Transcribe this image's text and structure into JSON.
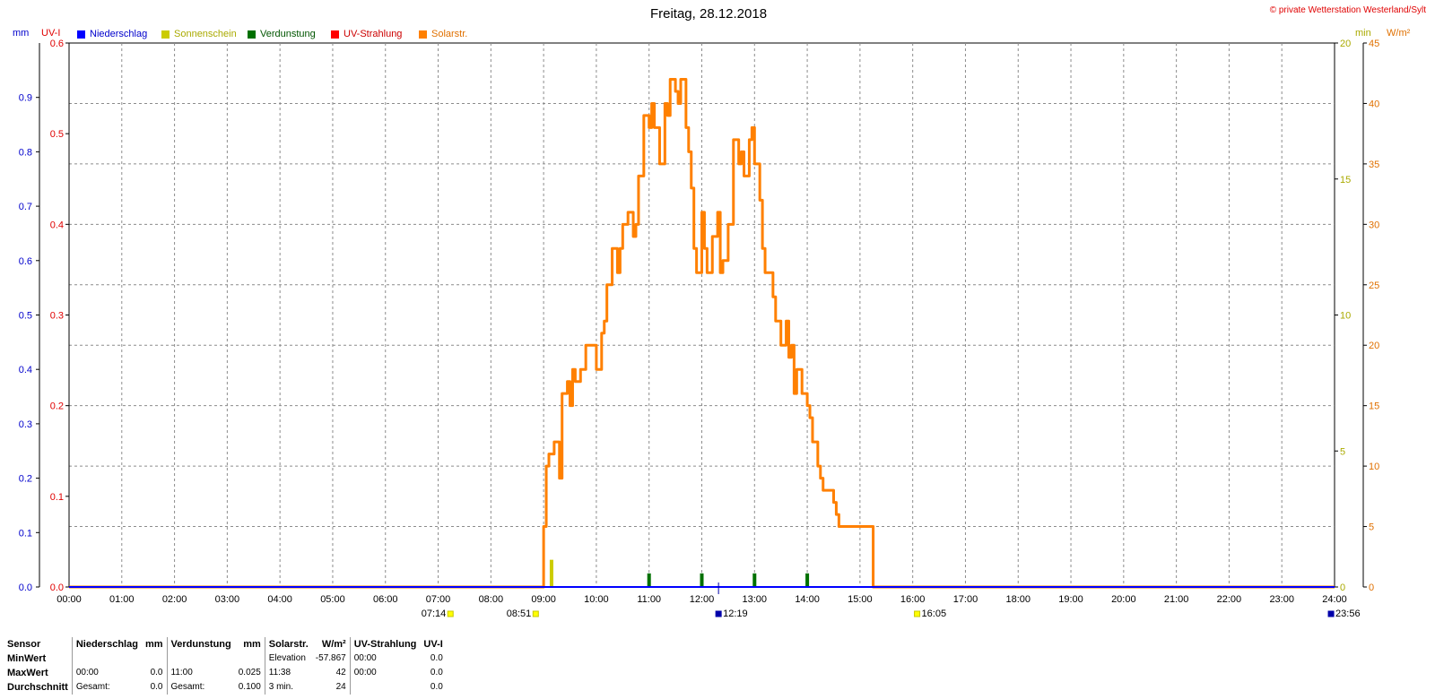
{
  "header": {
    "title": "Freitag, 28.12.2018",
    "copyright": "© private Wetterstation Westerland/Sylt"
  },
  "legend": [
    {
      "label": "Niederschlag",
      "color": "#0000ff",
      "text_color": "#0000cc"
    },
    {
      "label": "Sonnenschein",
      "color": "#cccc00",
      "text_color": "#aaaa00"
    },
    {
      "label": "Verdunstung",
      "color": "#007000",
      "text_color": "#005500"
    },
    {
      "label": "UV-Strahlung",
      "color": "#ff0000",
      "text_color": "#cc0000"
    },
    {
      "label": "Solarstr.",
      "color": "#ff8000",
      "text_color": "#e07000"
    }
  ],
  "axes": {
    "left_units": [
      "mm",
      "UV-I"
    ],
    "right_units": [
      "min",
      "W/m²"
    ],
    "mm_ticks": [
      "0.0",
      "0.1",
      "0.2",
      "0.3",
      "0.4",
      "0.5",
      "0.6",
      "0.7",
      "0.8",
      "0.9"
    ],
    "uv_ticks": [
      "0.0",
      "0.1",
      "0.2",
      "0.3",
      "0.4",
      "0.5",
      "0.6"
    ],
    "min_ticks": [
      "0",
      "5",
      "10",
      "15",
      "20"
    ],
    "wm2_ticks": [
      "0",
      "5",
      "10",
      "15",
      "20",
      "25",
      "30",
      "35",
      "40",
      "45"
    ],
    "x_ticks": [
      "00:00",
      "01:00",
      "02:00",
      "03:00",
      "04:00",
      "05:00",
      "06:00",
      "07:00",
      "08:00",
      "09:00",
      "10:00",
      "11:00",
      "12:00",
      "13:00",
      "14:00",
      "15:00",
      "16:00",
      "17:00",
      "18:00",
      "19:00",
      "20:00",
      "21:00",
      "22:00",
      "23:00",
      "24:00"
    ],
    "x_range_hours": [
      0,
      24
    ],
    "wm2_range": [
      0,
      45
    ],
    "min_range": [
      0,
      20
    ],
    "grid": true
  },
  "sun_markers": [
    {
      "label": "07:14",
      "hour": 7.233,
      "kind": "sunrise"
    },
    {
      "label": "08:51",
      "hour": 8.85,
      "kind": "sunrise-solar"
    },
    {
      "label": "12:19",
      "hour": 12.317,
      "kind": "noon"
    },
    {
      "label": "16:05",
      "hour": 16.083,
      "kind": "sunset"
    },
    {
      "label": "23:56",
      "hour": 23.933,
      "kind": "moon"
    }
  ],
  "chart_data": {
    "type": "line",
    "title": "Freitag, 28.12.2018",
    "xlabel": "",
    "ylabel": "W/m²",
    "xlim": [
      0,
      24
    ],
    "ylim": [
      0,
      45
    ],
    "series": [
      {
        "name": "Solarstr.",
        "unit": "W/m²",
        "color": "#ff8000",
        "x": [
          0,
          8.95,
          9.0,
          9.05,
          9.1,
          9.15,
          9.2,
          9.3,
          9.35,
          9.45,
          9.5,
          9.55,
          9.6,
          9.7,
          9.8,
          9.9,
          10.0,
          10.1,
          10.15,
          10.2,
          10.3,
          10.4,
          10.45,
          10.5,
          10.6,
          10.7,
          10.75,
          10.8,
          10.9,
          11.0,
          11.05,
          11.1,
          11.2,
          11.3,
          11.35,
          11.4,
          11.5,
          11.55,
          11.6,
          11.7,
          11.75,
          11.8,
          11.85,
          11.9,
          12.0,
          12.05,
          12.1,
          12.15,
          12.2,
          12.3,
          12.35,
          12.4,
          12.5,
          12.6,
          12.7,
          12.75,
          12.8,
          12.9,
          12.95,
          13.0,
          13.1,
          13.15,
          13.2,
          13.3,
          13.35,
          13.4,
          13.5,
          13.6,
          13.65,
          13.7,
          13.75,
          13.8,
          13.9,
          14.0,
          14.05,
          14.1,
          14.2,
          14.25,
          14.3,
          14.4,
          14.5,
          14.55,
          14.6,
          14.7,
          14.8,
          14.9,
          15.0,
          15.05,
          15.1,
          15.15,
          15.2,
          15.25,
          24
        ],
        "y": [
          0,
          0,
          5,
          10,
          11,
          11,
          12,
          9,
          16,
          17,
          15,
          18,
          17,
          18,
          20,
          20,
          18,
          21,
          22,
          25,
          28,
          26,
          28,
          30,
          31,
          29,
          30,
          34,
          39,
          38,
          40,
          38,
          35,
          40,
          39,
          42,
          41,
          40,
          42,
          38,
          36,
          33,
          28,
          26,
          31,
          28,
          26,
          26,
          29,
          31,
          26,
          27,
          30,
          37,
          35,
          36,
          34,
          37,
          38,
          35,
          32,
          28,
          26,
          26,
          24,
          22,
          20,
          22,
          19,
          20,
          16,
          18,
          16,
          15,
          14,
          12,
          10,
          9,
          8,
          8,
          7,
          6,
          5,
          5,
          5,
          5,
          5,
          5,
          5,
          5,
          5,
          0,
          0
        ],
        "summary": {
          "min": "00:00",
          "min_value": 0.0,
          "max_time": "11:38",
          "max_value": 42,
          "mean_3min": 24
        }
      },
      {
        "name": "UV-Strahlung",
        "unit": "UV-I",
        "color": "#ff0000",
        "x": [
          0,
          24
        ],
        "y": [
          0,
          0
        ]
      },
      {
        "name": "Niederschlag",
        "unit": "mm",
        "color": "#0000ff",
        "x": [
          0,
          24
        ],
        "y": [
          0,
          0
        ]
      },
      {
        "name": "Sonnenschein",
        "unit": "min",
        "color": "#cccc00",
        "bars": [
          {
            "x": 9.15,
            "y": 1.0
          }
        ]
      },
      {
        "name": "Verdunstung",
        "unit": "mm",
        "color": "#007000",
        "bars": [
          {
            "x": 11.0,
            "y": 0.025
          },
          {
            "x": 12.0,
            "y": 0.025
          },
          {
            "x": 13.0,
            "y": 0.025
          },
          {
            "x": 14.0,
            "y": 0.025
          }
        ]
      }
    ]
  },
  "stats": {
    "row_labels": [
      "Sensor",
      "MinWert",
      "MaxWert",
      "Durchschnitt"
    ],
    "niederschlag": {
      "header": "Niederschlag",
      "unit": "mm",
      "min": "",
      "max_time": "00:00",
      "max": "0.0",
      "avg_label": "Gesamt:",
      "avg": "0.0"
    },
    "verdunstung": {
      "header": "Verdunstung",
      "unit": "mm",
      "max_time": "11:00",
      "max": "0.025",
      "avg_label": "Gesamt:",
      "avg": "0.100"
    },
    "solar": {
      "header": "Solarstr.",
      "unit": "W/m²",
      "min_label": "Elevation",
      "min": "-57.867",
      "max_time": "11:38",
      "max": "42",
      "avg_label": "3 min.",
      "avg": "24"
    },
    "uv": {
      "header": "UV-Strahlung",
      "unit": "UV-I",
      "min_time": "00:00",
      "min": "0.0",
      "max_time": "00:00",
      "max": "0.0",
      "avg": "0.0"
    }
  }
}
